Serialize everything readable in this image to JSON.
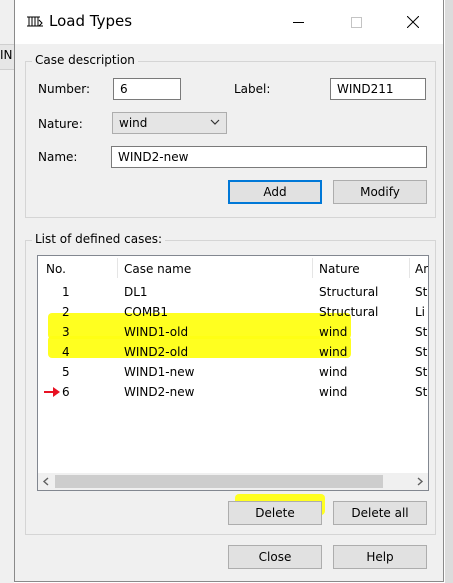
{
  "background": {
    "left_text": "IN"
  },
  "window": {
    "title": "Load Types",
    "app_icon": "load-types-app-icon"
  },
  "case_description": {
    "legend": "Case description",
    "number_label": "Number:",
    "number_value": "6",
    "label_label": "Label:",
    "label_value": "WIND211",
    "nature_label": "Nature:",
    "nature_value": "wind",
    "name_label": "Name:",
    "name_value": "WIND2-new",
    "add_button": "Add",
    "modify_button": "Modify"
  },
  "defined_cases": {
    "legend": "List of defined cases:",
    "columns": [
      "No.",
      "Case name",
      "Nature",
      "An"
    ],
    "rows": [
      {
        "no": "1",
        "name": "DL1",
        "nature": "Structural",
        "extra": "St",
        "highlighted": false,
        "current": false
      },
      {
        "no": "2",
        "name": "COMB1",
        "nature": "Structural",
        "extra": "Li",
        "highlighted": true,
        "current": false
      },
      {
        "no": "3",
        "name": "WIND1-old",
        "nature": "wind",
        "extra": "St",
        "highlighted": true,
        "current": false
      },
      {
        "no": "4",
        "name": "WIND2-old",
        "nature": "wind",
        "extra": "St",
        "highlighted": true,
        "current": false
      },
      {
        "no": "5",
        "name": "WIND1-new",
        "nature": "wind",
        "extra": "St",
        "highlighted": false,
        "current": false
      },
      {
        "no": "6",
        "name": "WIND2-new",
        "nature": "wind",
        "extra": "St",
        "highlighted": false,
        "current": true
      }
    ],
    "delete_button": "Delete",
    "delete_all_button": "Delete all"
  },
  "footer": {
    "close_button": "Close",
    "help_button": "Help"
  },
  "colors": {
    "highlight": "#ffff14",
    "current_arrow": "#e81123",
    "default_button_border": "#0078d7"
  }
}
